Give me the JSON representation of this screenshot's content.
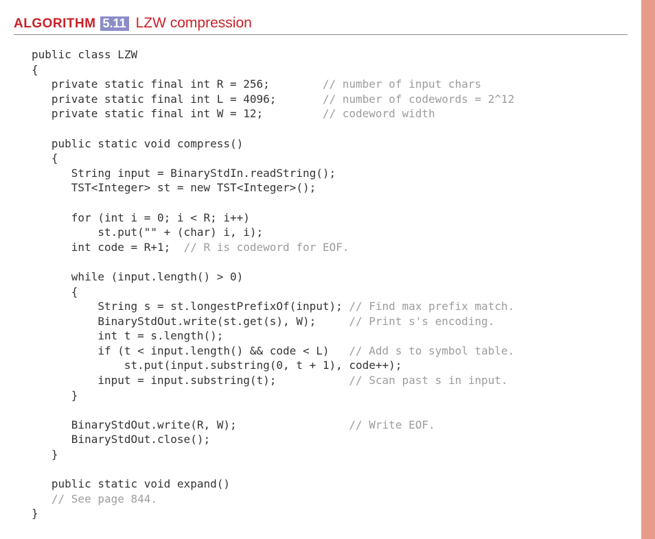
{
  "header": {
    "label": "ALGORITHM",
    "number": "5.11",
    "title": "LZW compression"
  },
  "code": {
    "l01": "public class LZW",
    "l02": "{",
    "l03a": "   private static final int R = 256;        ",
    "l03c": "// number of input chars",
    "l04a": "   private static final int L = 4096;       ",
    "l04c": "// number of codewords = 2^12",
    "l05a": "   private static final int W = 12;         ",
    "l05c": "// codeword width",
    "l06": "",
    "l07": "   public static void compress()",
    "l08": "   {",
    "l09": "      String input = BinaryStdIn.readString();",
    "l10": "      TST<Integer> st = new TST<Integer>();",
    "l11": "",
    "l12": "      for (int i = 0; i < R; i++)",
    "l13": "          st.put(\"\" + (char) i, i);",
    "l14a": "      int code = R+1;  ",
    "l14c": "// R is codeword for EOF.",
    "l15": "",
    "l16": "      while (input.length() > 0)",
    "l17": "      {",
    "l18a": "          String s = st.longestPrefixOf(input); ",
    "l18c": "// Find max prefix match.",
    "l19a": "          BinaryStdOut.write(st.get(s), W);     ",
    "l19c": "// Print s's encoding.",
    "l20": "          int t = s.length();",
    "l21a": "          if (t < input.length() && code < L)   ",
    "l21c": "// Add s to symbol table.",
    "l22": "              st.put(input.substring(0, t + 1), code++);",
    "l23a": "          input = input.substring(t);           ",
    "l23c": "// Scan past s in input.",
    "l24": "      }",
    "l25": "",
    "l26a": "      BinaryStdOut.write(R, W);                 ",
    "l26c": "// Write EOF.",
    "l27": "      BinaryStdOut.close();",
    "l28": "   }",
    "l29": "",
    "l30": "   public static void expand()",
    "l31c": "   // See page 844.",
    "l32": "}"
  }
}
